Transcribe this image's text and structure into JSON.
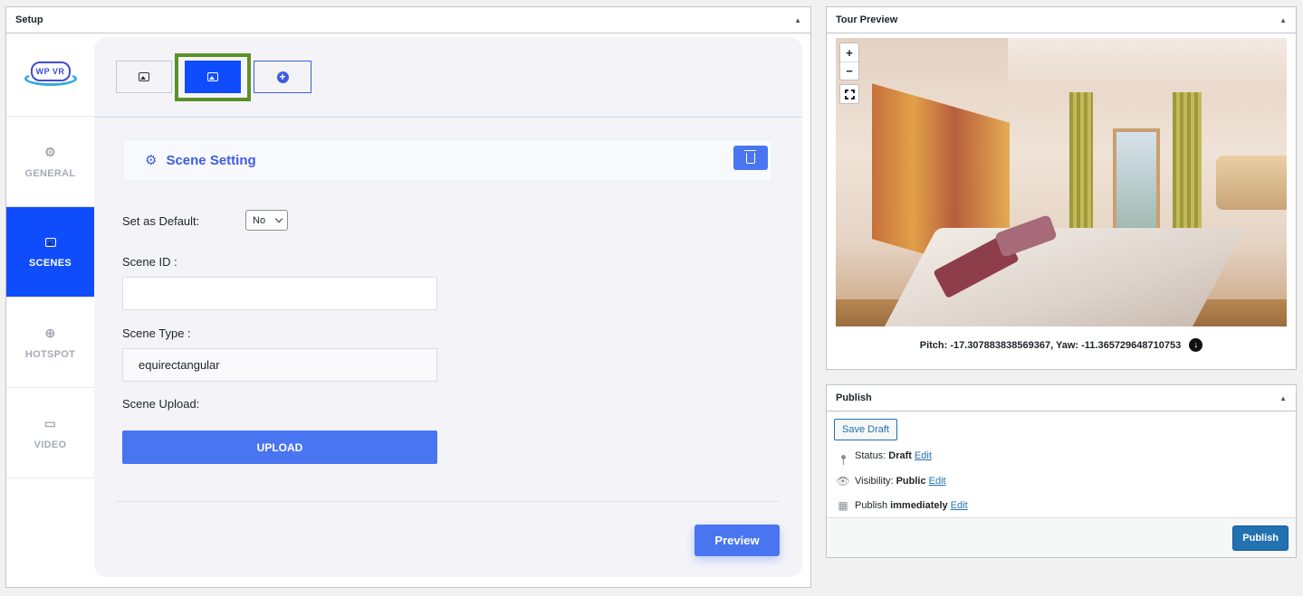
{
  "setup": {
    "title": "Setup",
    "logo_text": "WP VR",
    "nav": [
      {
        "label": "GENERAL",
        "icon": "gear-icon",
        "active": false
      },
      {
        "label": "SCENES",
        "icon": "image-icon",
        "active": true
      },
      {
        "label": "HOTSPOT",
        "icon": "crosshair-icon",
        "active": false
      },
      {
        "label": "VIDEO",
        "icon": "video-icon",
        "active": false
      }
    ],
    "scene_tabs": [
      {
        "icon": "image-icon",
        "active": false
      },
      {
        "icon": "image-icon",
        "active": true
      },
      {
        "icon": "add-circle-icon",
        "active": false
      }
    ],
    "scene_setting_title": "Scene Setting",
    "default_label": "Set as Default:",
    "default_value": "No",
    "scene_id_label": "Scene ID :",
    "scene_id_value": "",
    "scene_type_label": "Scene Type :",
    "scene_type_value": "equirectangular",
    "scene_upload_label": "Scene Upload:",
    "upload_button": "UPLOAD",
    "preview_button": "Preview",
    "accent_color": "#0f4cfc",
    "button_color": "#4a75f0",
    "highlight_frame_color": "#5c9027"
  },
  "tour_preview": {
    "title": "Tour Preview",
    "zoom_in": "+",
    "zoom_out": "−",
    "coords_text": "Pitch: -17.307883838569367, Yaw: -11.365729648710753"
  },
  "publish": {
    "title": "Publish",
    "save_draft": "Save Draft",
    "status_label": "Status:",
    "status_value": "Draft",
    "visibility_label": "Visibility:",
    "visibility_value": "Public",
    "publish_label": "Publish",
    "publish_value": "immediately",
    "edit_link": "Edit",
    "publish_button": "Publish",
    "link_color": "#2271b1"
  }
}
